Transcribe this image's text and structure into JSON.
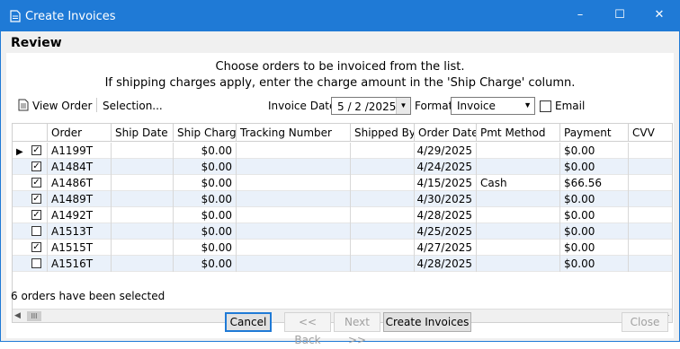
{
  "window": {
    "title": "Create Invoices",
    "minimize": "–",
    "maximize": "☐",
    "close": "✕",
    "accent": "#1f7ad6"
  },
  "heading": "Review",
  "instructions": {
    "line1": "Choose orders to be invoiced from the list.",
    "line2": "If shipping charges apply, enter the charge amount in the 'Ship Charge' column."
  },
  "toolbar": {
    "view_order": "View Order",
    "selection": "Selection...",
    "invoice_date_label": "Invoice Date",
    "invoice_date": "5 / 2 /2025",
    "format_label": "Format",
    "format_value": "Invoice",
    "email_label": "Email",
    "email_checked": false
  },
  "grid": {
    "columns": [
      "Order",
      "Ship Date",
      "Ship Charge",
      "Tracking Number",
      "Shipped By",
      "Order Date",
      "Pmt Method",
      "Payment",
      "CVV"
    ],
    "rows": [
      {
        "checked": true,
        "order": "A1199T",
        "ship_date": "",
        "ship_charge": "$0.00",
        "tracking": "",
        "shipped_by": "",
        "order_date": "4/29/2025",
        "pmt_method": "",
        "payment": "$0.00",
        "cvv": "",
        "current": true
      },
      {
        "checked": true,
        "order": "A1484T",
        "ship_date": "",
        "ship_charge": "$0.00",
        "tracking": "",
        "shipped_by": "",
        "order_date": "4/24/2025",
        "pmt_method": "",
        "payment": "$0.00",
        "cvv": ""
      },
      {
        "checked": true,
        "order": "A1486T",
        "ship_date": "",
        "ship_charge": "$0.00",
        "tracking": "",
        "shipped_by": "",
        "order_date": "4/15/2025",
        "pmt_method": "Cash",
        "payment": "$66.56",
        "cvv": ""
      },
      {
        "checked": true,
        "order": "A1489T",
        "ship_date": "",
        "ship_charge": "$0.00",
        "tracking": "",
        "shipped_by": "",
        "order_date": "4/30/2025",
        "pmt_method": "",
        "payment": "$0.00",
        "cvv": ""
      },
      {
        "checked": true,
        "order": "A1492T",
        "ship_date": "",
        "ship_charge": "$0.00",
        "tracking": "",
        "shipped_by": "",
        "order_date": "4/28/2025",
        "pmt_method": "",
        "payment": "$0.00",
        "cvv": ""
      },
      {
        "checked": false,
        "order": "A1513T",
        "ship_date": "",
        "ship_charge": "$0.00",
        "tracking": "",
        "shipped_by": "",
        "order_date": "4/25/2025",
        "pmt_method": "",
        "payment": "$0.00",
        "cvv": ""
      },
      {
        "checked": true,
        "order": "A1515T",
        "ship_date": "",
        "ship_charge": "$0.00",
        "tracking": "",
        "shipped_by": "",
        "order_date": "4/27/2025",
        "pmt_method": "",
        "payment": "$0.00",
        "cvv": ""
      },
      {
        "checked": false,
        "order": "A1516T",
        "ship_date": "",
        "ship_charge": "$0.00",
        "tracking": "",
        "shipped_by": "",
        "order_date": "4/28/2025",
        "pmt_method": "",
        "payment": "$0.00",
        "cvv": ""
      }
    ]
  },
  "status": "6 orders have been selected",
  "buttons": {
    "cancel": "Cancel",
    "back": "<< Back",
    "next": "Next >>",
    "create": "Create Invoices",
    "close": "Close"
  }
}
